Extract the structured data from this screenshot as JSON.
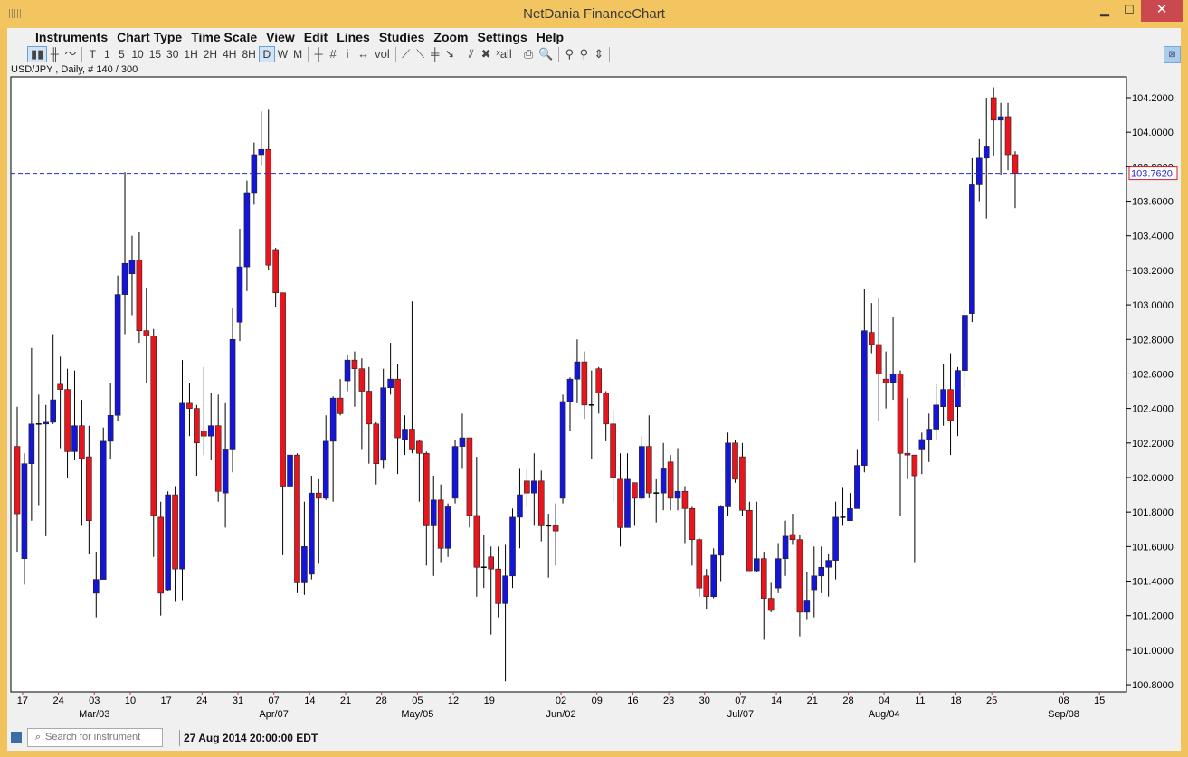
{
  "window": {
    "title": "NetDania FinanceChart",
    "minimize": "▁",
    "maximize": "☐",
    "close": "✕"
  },
  "menu": [
    "Instruments",
    "Chart Type",
    "Time Scale",
    "View",
    "Edit",
    "Lines",
    "Studies",
    "Zoom",
    "Settings",
    "Help"
  ],
  "toolbar": {
    "chart_types": [
      {
        "icon": "candlestick-icon",
        "glyph": "▮▮",
        "selected": true
      },
      {
        "icon": "ohlc-bar-icon",
        "glyph": "╫"
      },
      {
        "icon": "line-chart-icon",
        "glyph": "〜"
      }
    ],
    "timescales": [
      {
        "label": "T"
      },
      {
        "label": "1"
      },
      {
        "label": "5"
      },
      {
        "label": "10"
      },
      {
        "label": "15"
      },
      {
        "label": "30"
      },
      {
        "label": "1H"
      },
      {
        "label": "2H"
      },
      {
        "label": "4H"
      },
      {
        "label": "8H"
      },
      {
        "label": "D",
        "selected": true
      },
      {
        "label": "W"
      },
      {
        "label": "M"
      }
    ],
    "tools1": [
      {
        "icon": "crosshair-icon",
        "glyph": "┼"
      },
      {
        "icon": "grid-icon",
        "glyph": "#"
      },
      {
        "icon": "info-icon",
        "glyph": "i"
      },
      {
        "icon": "scroll-arrows-icon",
        "glyph": "↔"
      },
      {
        "icon": "volume-icon",
        "glyph": "vol"
      }
    ],
    "tools2": [
      {
        "icon": "trend-line-icon",
        "glyph": "⟋"
      },
      {
        "icon": "ray-line-icon",
        "glyph": "⟍"
      },
      {
        "icon": "fibonacci-icon",
        "glyph": "╪"
      },
      {
        "icon": "arrow-line-icon",
        "glyph": "➘"
      }
    ],
    "tools3": [
      {
        "icon": "eraser-icon",
        "glyph": "⫽"
      },
      {
        "icon": "delete-icon",
        "glyph": "✖"
      },
      {
        "icon": "delete-all-icon",
        "glyph": "ˣall"
      }
    ],
    "tools4": [
      {
        "icon": "print-icon",
        "glyph": "⎙"
      },
      {
        "icon": "print-preview-icon",
        "glyph": "🔍"
      }
    ],
    "tools5": [
      {
        "icon": "zoom-in-icon",
        "glyph": "⚲"
      },
      {
        "icon": "zoom-out-icon",
        "glyph": "⚲"
      },
      {
        "icon": "fit-icon",
        "glyph": "⇕"
      }
    ]
  },
  "info_label": "USD/JPY , Daily, # 140 / 300",
  "status": {
    "search_placeholder": "Search for instrument",
    "datetime": "27 Aug 2014 20:00:00 EDT"
  },
  "colors": {
    "up": "#1515d6",
    "down": "#e8161c",
    "current_line": "#2a2ad0",
    "current_label_border": "#d02020"
  },
  "chart_data": {
    "type": "candlestick",
    "instrument": "USD/JPY",
    "interval": "Daily",
    "first_date": "2014-02-14",
    "ylim": [
      100.76,
      104.3
    ],
    "y_ticks": [
      "104.2000",
      "104.0000",
      "103.8000",
      "103.6000",
      "103.4000",
      "103.2000",
      "103.0000",
      "102.8000",
      "102.6000",
      "102.4000",
      "102.2000",
      "102.0000",
      "101.8000",
      "101.6000",
      "101.4000",
      "101.2000",
      "101.0000",
      "100.8000"
    ],
    "current_price": "103.7620",
    "x_ticks": [
      {
        "label": "17",
        "date": "2014-02-17"
      },
      {
        "label": "24",
        "date": "2014-02-24"
      },
      {
        "label": "03",
        "date": "2014-03-03"
      },
      {
        "label": "10",
        "date": "2014-03-10"
      },
      {
        "label": "17",
        "date": "2014-03-17"
      },
      {
        "label": "24",
        "date": "2014-03-24"
      },
      {
        "label": "31",
        "date": "2014-03-31"
      },
      {
        "label": "07",
        "date": "2014-04-07"
      },
      {
        "label": "14",
        "date": "2014-04-14"
      },
      {
        "label": "21",
        "date": "2014-04-21"
      },
      {
        "label": "28",
        "date": "2014-04-28"
      },
      {
        "label": "05",
        "date": "2014-05-05"
      },
      {
        "label": "12",
        "date": "2014-05-12"
      },
      {
        "label": "19",
        "date": "2014-05-19"
      },
      {
        "label": "02",
        "date": "2014-06-02"
      },
      {
        "label": "09",
        "date": "2014-06-09"
      },
      {
        "label": "16",
        "date": "2014-06-16"
      },
      {
        "label": "23",
        "date": "2014-06-23"
      },
      {
        "label": "30",
        "date": "2014-06-30"
      },
      {
        "label": "07",
        "date": "2014-07-07"
      },
      {
        "label": "14",
        "date": "2014-07-14"
      },
      {
        "label": "21",
        "date": "2014-07-21"
      },
      {
        "label": "28",
        "date": "2014-07-28"
      },
      {
        "label": "04",
        "date": "2014-08-04"
      },
      {
        "label": "11",
        "date": "2014-08-11"
      },
      {
        "label": "18",
        "date": "2014-08-18"
      },
      {
        "label": "25",
        "date": "2014-08-25"
      },
      {
        "label": "08",
        "date": "2014-09-08"
      },
      {
        "label": "15",
        "date": "2014-09-15"
      }
    ],
    "month_labels": [
      {
        "label": "Mar/03",
        "date": "2014-03-03"
      },
      {
        "label": "Apr/07",
        "date": "2014-04-07"
      },
      {
        "label": "May/05",
        "date": "2014-05-05"
      },
      {
        "label": "Jun/02",
        "date": "2014-06-02"
      },
      {
        "label": "Jul/07",
        "date": "2014-07-07"
      },
      {
        "label": "Aug/04",
        "date": "2014-08-04"
      },
      {
        "label": "Sep/08",
        "date": "2014-09-08"
      }
    ],
    "ohlc_fields": [
      "open",
      "high",
      "low",
      "close"
    ],
    "candles": [
      [
        102.18,
        102.41,
        101.57,
        101.79
      ],
      [
        101.53,
        102.14,
        101.38,
        102.08
      ],
      [
        102.08,
        102.75,
        101.75,
        102.31
      ],
      [
        102.31,
        102.48,
        101.84,
        102.31
      ],
      [
        102.31,
        102.42,
        101.66,
        102.32
      ],
      [
        102.32,
        102.83,
        102.31,
        102.45
      ],
      [
        102.54,
        102.7,
        102.17,
        102.51
      ],
      [
        102.51,
        102.63,
        102.0,
        102.15
      ],
      [
        102.15,
        102.62,
        102.1,
        102.3
      ],
      [
        102.3,
        102.45,
        101.72,
        102.11
      ],
      [
        102.12,
        102.3,
        101.56,
        101.75
      ],
      [
        101.33,
        101.57,
        101.19,
        101.41
      ],
      [
        101.41,
        102.29,
        101.41,
        102.21
      ],
      [
        102.21,
        102.55,
        102.11,
        102.36
      ],
      [
        102.36,
        103.17,
        102.33,
        103.06
      ],
      [
        103.06,
        103.77,
        102.83,
        103.24
      ],
      [
        103.18,
        103.4,
        102.94,
        103.26
      ],
      [
        103.26,
        103.42,
        102.78,
        102.85
      ],
      [
        102.85,
        103.1,
        102.55,
        102.82
      ],
      [
        102.82,
        102.86,
        101.54,
        101.78
      ],
      [
        101.77,
        101.86,
        101.2,
        101.33
      ],
      [
        101.35,
        101.92,
        101.34,
        101.9
      ],
      [
        101.9,
        101.95,
        101.28,
        101.47
      ],
      [
        101.47,
        102.68,
        101.29,
        102.43
      ],
      [
        102.43,
        102.55,
        102.24,
        102.4
      ],
      [
        102.4,
        102.42,
        102.01,
        102.2
      ],
      [
        102.27,
        102.64,
        102.13,
        102.24
      ],
      [
        102.24,
        102.49,
        102.1,
        102.3
      ],
      [
        102.3,
        102.48,
        101.86,
        101.92
      ],
      [
        101.91,
        102.43,
        101.71,
        102.16
      ],
      [
        102.16,
        102.98,
        102.03,
        102.8
      ],
      [
        102.9,
        103.44,
        102.79,
        103.22
      ],
      [
        103.22,
        103.72,
        103.08,
        103.65
      ],
      [
        103.65,
        103.94,
        103.58,
        103.87
      ],
      [
        103.87,
        104.12,
        103.81,
        103.9
      ],
      [
        103.9,
        104.13,
        103.2,
        103.23
      ],
      [
        103.32,
        103.33,
        102.99,
        103.07
      ],
      [
        103.07,
        103.07,
        101.55,
        101.95
      ],
      [
        101.95,
        102.16,
        101.71,
        102.13
      ],
      [
        102.13,
        102.14,
        101.33,
        101.39
      ],
      [
        101.39,
        101.86,
        101.32,
        101.6
      ],
      [
        101.44,
        102.01,
        101.41,
        101.91
      ],
      [
        101.91,
        101.99,
        101.5,
        101.88
      ],
      [
        101.88,
        102.36,
        101.87,
        102.21
      ],
      [
        102.21,
        102.47,
        101.86,
        102.46
      ],
      [
        102.46,
        102.57,
        102.36,
        102.37
      ],
      [
        102.56,
        102.71,
        102.5,
        102.68
      ],
      [
        102.68,
        102.73,
        102.41,
        102.63
      ],
      [
        102.63,
        102.69,
        102.16,
        102.5
      ],
      [
        102.5,
        102.64,
        102.08,
        102.31
      ],
      [
        102.31,
        102.32,
        101.96,
        102.08
      ],
      [
        102.1,
        102.63,
        102.05,
        102.52
      ],
      [
        102.52,
        102.78,
        102.48,
        102.57
      ],
      [
        102.57,
        102.66,
        102.02,
        102.23
      ],
      [
        102.22,
        102.36,
        102.13,
        102.28
      ],
      [
        102.28,
        103.02,
        102.14,
        102.16
      ],
      [
        102.21,
        102.22,
        101.86,
        102.14
      ],
      [
        102.14,
        102.15,
        101.49,
        101.72
      ],
      [
        101.72,
        102.01,
        101.43,
        101.87
      ],
      [
        101.87,
        101.96,
        101.51,
        101.59
      ],
      [
        101.59,
        101.85,
        101.54,
        101.83
      ],
      [
        101.88,
        102.22,
        101.85,
        102.18
      ],
      [
        102.18,
        102.37,
        102.05,
        102.23
      ],
      [
        102.23,
        102.23,
        101.71,
        101.78
      ],
      [
        101.78,
        102.12,
        101.31,
        101.48
      ],
      [
        101.48,
        101.67,
        101.36,
        101.48
      ],
      [
        101.54,
        101.6,
        101.09,
        101.47
      ],
      [
        101.47,
        101.6,
        101.19,
        101.27
      ],
      [
        101.27,
        101.61,
        100.82,
        101.43
      ],
      [
        101.43,
        101.82,
        101.36,
        101.77
      ],
      [
        101.77,
        102.05,
        101.59,
        101.9
      ],
      [
        101.98,
        102.06,
        101.83,
        101.91
      ],
      [
        101.91,
        102.14,
        101.72,
        101.98
      ],
      [
        101.98,
        102.04,
        101.63,
        101.72
      ],
      [
        101.72,
        101.79,
        101.42,
        101.72
      ],
      [
        101.72,
        101.85,
        101.49,
        101.69
      ],
      [
        101.88,
        102.48,
        101.85,
        102.44
      ],
      [
        102.44,
        102.58,
        102.27,
        102.57
      ],
      [
        102.57,
        102.8,
        102.43,
        102.67
      ],
      [
        102.67,
        102.73,
        102.34,
        102.42
      ],
      [
        102.42,
        102.62,
        102.11,
        102.42
      ],
      [
        102.63,
        102.64,
        102.37,
        102.49
      ],
      [
        102.49,
        102.5,
        102.21,
        102.31
      ],
      [
        102.31,
        102.39,
        101.86,
        102.0
      ],
      [
        101.99,
        102.14,
        101.6,
        101.71
      ],
      [
        101.71,
        102.14,
        101.71,
        101.99
      ],
      [
        101.97,
        101.97,
        101.72,
        101.88
      ],
      [
        101.88,
        102.24,
        101.87,
        102.18
      ],
      [
        102.18,
        102.36,
        101.88,
        101.91
      ],
      [
        101.91,
        101.99,
        101.74,
        101.91
      ],
      [
        101.91,
        102.2,
        101.81,
        102.05
      ],
      [
        102.09,
        102.13,
        101.81,
        101.88
      ],
      [
        101.88,
        102.17,
        101.81,
        101.92
      ],
      [
        101.92,
        101.95,
        101.62,
        101.82
      ],
      [
        101.82,
        101.83,
        101.49,
        101.64
      ],
      [
        101.64,
        101.65,
        101.31,
        101.36
      ],
      [
        101.43,
        101.47,
        101.24,
        101.31
      ],
      [
        101.31,
        101.59,
        101.3,
        101.55
      ],
      [
        101.55,
        101.84,
        101.4,
        101.83
      ],
      [
        101.83,
        102.26,
        101.78,
        102.2
      ],
      [
        102.2,
        102.22,
        101.97,
        101.99
      ],
      [
        102.12,
        102.2,
        101.78,
        101.81
      ],
      [
        101.81,
        101.86,
        101.46,
        101.46
      ],
      [
        101.46,
        101.86,
        101.45,
        101.53
      ],
      [
        101.53,
        101.57,
        101.06,
        101.3
      ],
      [
        101.3,
        101.39,
        101.22,
        101.23
      ],
      [
        101.36,
        101.62,
        101.33,
        101.53
      ],
      [
        101.53,
        101.75,
        101.43,
        101.66
      ],
      [
        101.67,
        101.79,
        101.61,
        101.64
      ],
      [
        101.64,
        101.67,
        101.08,
        101.22
      ],
      [
        101.22,
        101.45,
        101.18,
        101.29
      ],
      [
        101.35,
        101.6,
        101.19,
        101.43
      ],
      [
        101.43,
        101.6,
        101.33,
        101.48
      ],
      [
        101.48,
        101.56,
        101.31,
        101.52
      ],
      [
        101.52,
        101.86,
        101.41,
        101.77
      ],
      [
        101.77,
        101.94,
        101.72,
        101.77
      ],
      [
        101.75,
        101.91,
        101.75,
        101.82
      ],
      [
        101.82,
        102.16,
        101.82,
        102.07
      ],
      [
        102.07,
        103.09,
        102.03,
        102.85
      ],
      [
        102.84,
        103.01,
        102.72,
        102.77
      ],
      [
        102.77,
        103.04,
        102.33,
        102.6
      ],
      [
        102.57,
        102.73,
        102.4,
        102.55
      ],
      [
        102.55,
        102.93,
        102.45,
        102.6
      ],
      [
        102.6,
        102.62,
        101.78,
        102.14
      ],
      [
        102.14,
        102.46,
        101.99,
        102.13
      ],
      [
        102.13,
        102.13,
        101.51,
        102.01
      ],
      [
        102.16,
        102.26,
        102.02,
        102.22
      ],
      [
        102.22,
        102.37,
        102.09,
        102.28
      ],
      [
        102.28,
        102.54,
        102.22,
        102.42
      ],
      [
        102.41,
        102.66,
        102.3,
        102.51
      ],
      [
        102.51,
        102.72,
        102.13,
        102.33
      ],
      [
        102.41,
        102.64,
        102.24,
        102.62
      ],
      [
        102.62,
        102.97,
        102.52,
        102.94
      ],
      [
        102.95,
        103.85,
        102.9,
        103.7
      ],
      [
        103.7,
        103.96,
        103.6,
        103.85
      ],
      [
        103.85,
        104.2,
        103.5,
        103.92
      ],
      [
        104.2,
        104.26,
        103.86,
        104.07
      ],
      [
        104.07,
        104.17,
        103.75,
        104.09
      ],
      [
        104.09,
        104.17,
        103.78,
        103.87
      ],
      [
        103.87,
        103.89,
        103.56,
        103.762
      ]
    ]
  }
}
